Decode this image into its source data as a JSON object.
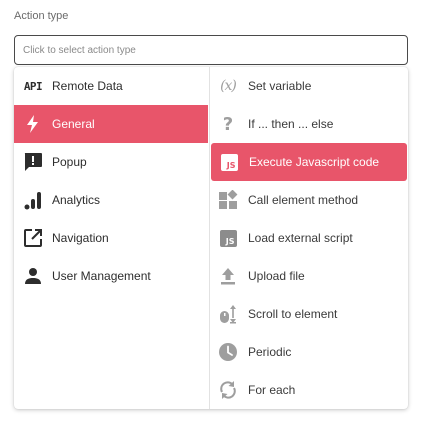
{
  "field": {
    "label": "Action type",
    "placeholder": "Click to select action type"
  },
  "categories": [
    {
      "label": "Remote Data",
      "icon": "api-icon",
      "icon_text": "API",
      "active": false
    },
    {
      "label": "General",
      "icon": "lightning-bolt-icon",
      "active": true
    },
    {
      "label": "Popup",
      "icon": "popup-alert-icon",
      "active": false
    },
    {
      "label": "Analytics",
      "icon": "bar-chart-icon",
      "active": false
    },
    {
      "label": "Navigation",
      "icon": "open-in-new-icon",
      "active": false
    },
    {
      "label": "User Management",
      "icon": "person-icon",
      "active": false
    }
  ],
  "actions": [
    {
      "label": "Set variable",
      "icon": "function-variable-icon",
      "icon_text": "(x)",
      "active": false
    },
    {
      "label": "If ... then ... else",
      "icon": "question-mark-icon",
      "icon_text": "?",
      "active": false
    },
    {
      "label": "Execute Javascript code",
      "icon": "javascript-icon",
      "icon_text": "JS",
      "active": true
    },
    {
      "label": "Call element method",
      "icon": "widgets-icon",
      "active": false
    },
    {
      "label": "Load external script",
      "icon": "javascript-file-icon",
      "icon_text": "JS",
      "active": false
    },
    {
      "label": "Upload file",
      "icon": "upload-icon",
      "active": false
    },
    {
      "label": "Scroll to element",
      "icon": "scroll-mouse-icon",
      "active": false
    },
    {
      "label": "Periodic",
      "icon": "clock-icon",
      "active": false
    },
    {
      "label": "For each",
      "icon": "loop-icon",
      "active": false
    }
  ],
  "colors": {
    "accent": "#e8556a",
    "icon_grey": "#9e9e9e",
    "icon_dark": "#2d2d2d"
  }
}
